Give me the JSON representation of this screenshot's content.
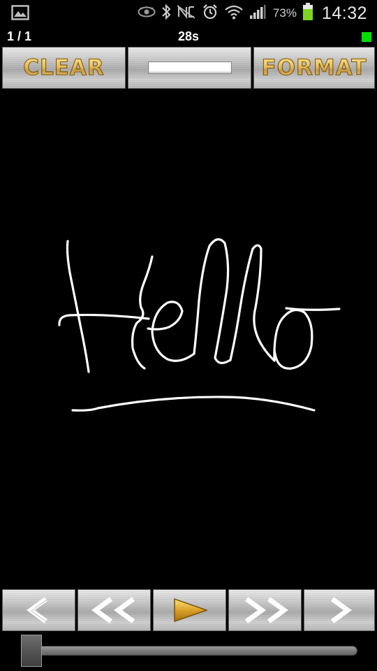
{
  "status_bar": {
    "icons": [
      "gallery-icon",
      "eye-icon",
      "bluetooth-icon",
      "nfc-icon",
      "alarm-icon",
      "wifi-icon",
      "signal-icon",
      "battery-icon"
    ],
    "battery_percent": "73%",
    "battery_level": 0.73,
    "time": "14:32"
  },
  "info": {
    "page_counter": "1 / 1",
    "timer": "28s",
    "status_led_color": "#00e000"
  },
  "toolbar": {
    "clear_label": "CLEAR",
    "format_label": "FORMAT",
    "pen_color": "#ffffff"
  },
  "canvas": {
    "background": "#000000",
    "stroke_color": "#ffffff"
  },
  "playback": {
    "prev_label": "<",
    "rewind_label": "<<",
    "fast_forward_label": ">>",
    "next_label": ">"
  },
  "slider": {
    "position": 0.0
  },
  "colors": {
    "gold": "#d9a12a",
    "metal": "#c0c0c0"
  }
}
